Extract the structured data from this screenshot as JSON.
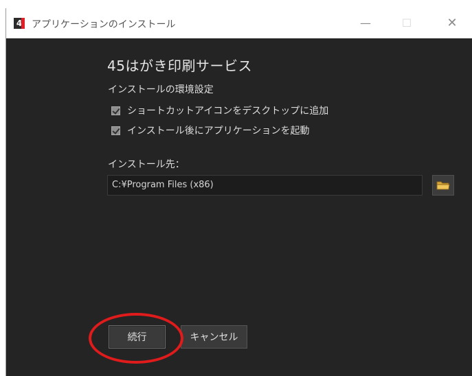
{
  "window": {
    "title": "アプリケーションのインストール",
    "logo_text": "4",
    "minimize_glyph": "—",
    "maximize_glyph": "☐",
    "close_glyph": "✕"
  },
  "installer": {
    "app_name": "45はがき印刷サービス",
    "settings_label": "インストールの環境設定",
    "options": [
      {
        "label": "ショートカットアイコンをデスクトップに追加",
        "checked": true
      },
      {
        "label": "インストール後にアプリケーションを起動",
        "checked": true
      }
    ],
    "destination_label": "インストール先：",
    "destination_value": "C:¥Program Files (x86)"
  },
  "buttons": {
    "continue_label": "続行",
    "cancel_label": "キャンセル"
  },
  "colors": {
    "highlight": "#e01b1b",
    "background": "#242424",
    "brand": "#e21e26"
  },
  "icons": {
    "browse": "folder-icon"
  }
}
